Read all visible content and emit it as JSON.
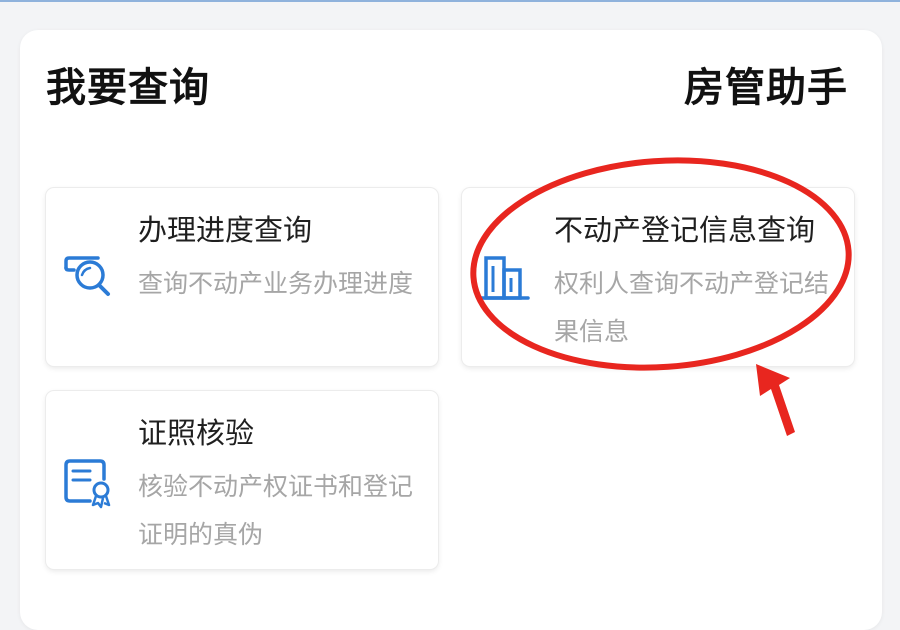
{
  "header": {
    "title": "我要查询",
    "brand": "房管助手"
  },
  "cards": [
    {
      "icon": "search-progress-icon",
      "title": "办理进度查询",
      "desc": "查询不动产业务办理进度"
    },
    {
      "icon": "building-icon",
      "title": "不动产登记信息查询",
      "desc": "权利人查询不动产登记结果信息"
    },
    {
      "icon": "certificate-icon",
      "title": "证照核验",
      "desc": "核验不动产权证书和登记证明的真伪"
    }
  ],
  "colors": {
    "icon_blue": "#2b7bd6",
    "annotation_red": "#e8261f",
    "desc_gray": "#a6a6a6"
  },
  "annotation": {
    "type": "red-ellipse-with-arrow",
    "target": "不动产登记信息查询"
  }
}
